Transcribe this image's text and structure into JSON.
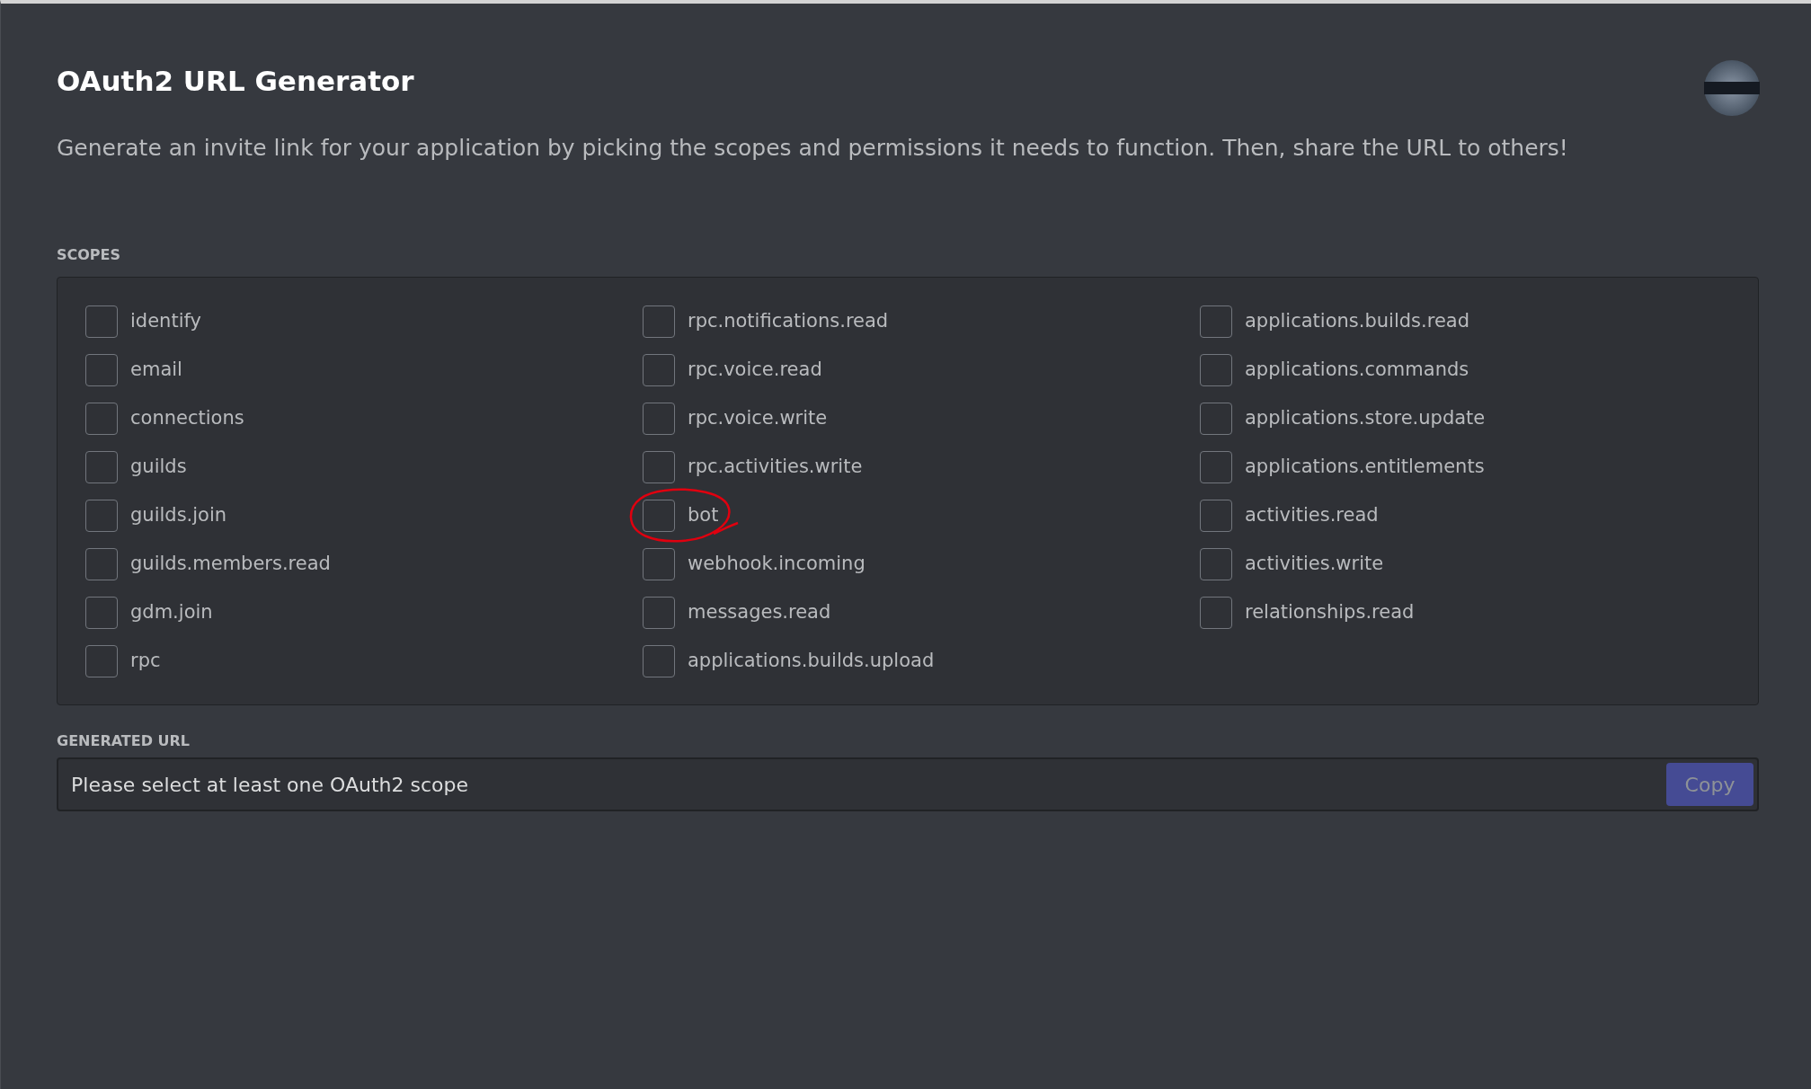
{
  "title": "OAuth2 URL Generator",
  "description": "Generate an invite link for your application by picking the scopes and permissions it needs to function. Then, share the URL to others!",
  "scopes_label": "SCOPES",
  "scope_columns": [
    [
      {
        "label": "identify",
        "checked": false
      },
      {
        "label": "email",
        "checked": false
      },
      {
        "label": "connections",
        "checked": false
      },
      {
        "label": "guilds",
        "checked": false
      },
      {
        "label": "guilds.join",
        "checked": false
      },
      {
        "label": "guilds.members.read",
        "checked": false
      },
      {
        "label": "gdm.join",
        "checked": false
      },
      {
        "label": "rpc",
        "checked": false
      }
    ],
    [
      {
        "label": "rpc.notifications.read",
        "checked": false
      },
      {
        "label": "rpc.voice.read",
        "checked": false
      },
      {
        "label": "rpc.voice.write",
        "checked": false
      },
      {
        "label": "rpc.activities.write",
        "checked": false
      },
      {
        "label": "bot",
        "checked": false,
        "circled": true
      },
      {
        "label": "webhook.incoming",
        "checked": false
      },
      {
        "label": "messages.read",
        "checked": false
      },
      {
        "label": "applications.builds.upload",
        "checked": false
      }
    ],
    [
      {
        "label": "applications.builds.read",
        "checked": false
      },
      {
        "label": "applications.commands",
        "checked": false
      },
      {
        "label": "applications.store.update",
        "checked": false
      },
      {
        "label": "applications.entitlements",
        "checked": false
      },
      {
        "label": "activities.read",
        "checked": false
      },
      {
        "label": "activities.write",
        "checked": false
      },
      {
        "label": "relationships.read",
        "checked": false
      }
    ]
  ],
  "generated_url_label": "GENERATED URL",
  "generated_url": {
    "value": "Please select at least one OAuth2 scope",
    "copy_button": "Copy",
    "copy_disabled": true
  }
}
